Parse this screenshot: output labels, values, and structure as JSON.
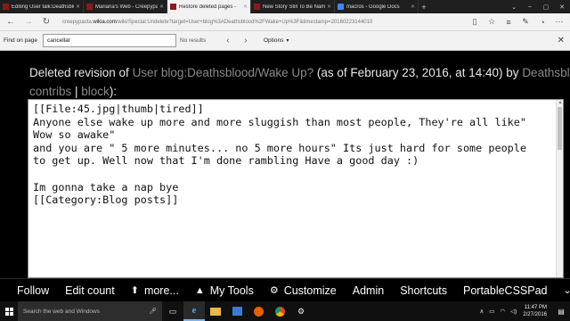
{
  "browser": {
    "tabs": [
      {
        "label": "Editing User talk:Deathsblo",
        "active": false,
        "favicon": "creepypasta-favicon"
      },
      {
        "label": "Mariana's Web - Creepypas",
        "active": false,
        "favicon": "creepypasta-favicon"
      },
      {
        "label": "Restore deleted pages -",
        "active": true,
        "favicon": "creepypasta-favicon"
      },
      {
        "label": "New Story Still To Be Name",
        "active": false,
        "favicon": "creepypasta-favicon"
      },
      {
        "label": "macros - Google Docs",
        "active": false,
        "favicon": "google-docs-favicon"
      }
    ],
    "new_tab_icon": "plus-icon",
    "url_prefix": "creepypasta.",
    "url_domain": "wikia.com",
    "url_rest": "/wiki/Special:Undelete?target=User+blog%3ADeathsblood%2FWake+Up%3F&timestamp=20160223144010"
  },
  "findbar": {
    "label": "Find on page",
    "query": "cancellat",
    "result": "No results",
    "options_label": "Options"
  },
  "page": {
    "heading_prefix": "Deleted revision of ",
    "heading_link": "User blog:Deathsblood/Wake Up?",
    "heading_date": " (as of February 23, 2016, at 14:40) by ",
    "heading_user": "Deathsblood",
    "contribs_link": "contribs",
    "separator": " | ",
    "block_link": "block",
    "close_paren": "):",
    "open_paren": "("
  },
  "editor": {
    "text": "[[File:45.jpg|thumb|tired]]\nAnyone else wake up more and more sluggish than most people, They're all like\"\nWow so awake\"\nand you are \" 5 more minutes... no 5 more hours\" Its just hard for some people\nto get up. Well now that I'm done rambling Have a good day :)\n\nIm gonna take a nap bye\n[[Category:Blog posts]]"
  },
  "wikibar": {
    "follow": "Follow",
    "edit_count": "Edit count",
    "more": "more...",
    "my_tools": "My Tools",
    "customize": "Customize",
    "admin": "Admin",
    "shortcuts": "Shortcuts",
    "portable_css_pad": "PortableCSSPad"
  },
  "taskbar": {
    "search_placeholder": "Search the web and Windows",
    "time": "11:47 PM",
    "date": "2/27/2016"
  }
}
